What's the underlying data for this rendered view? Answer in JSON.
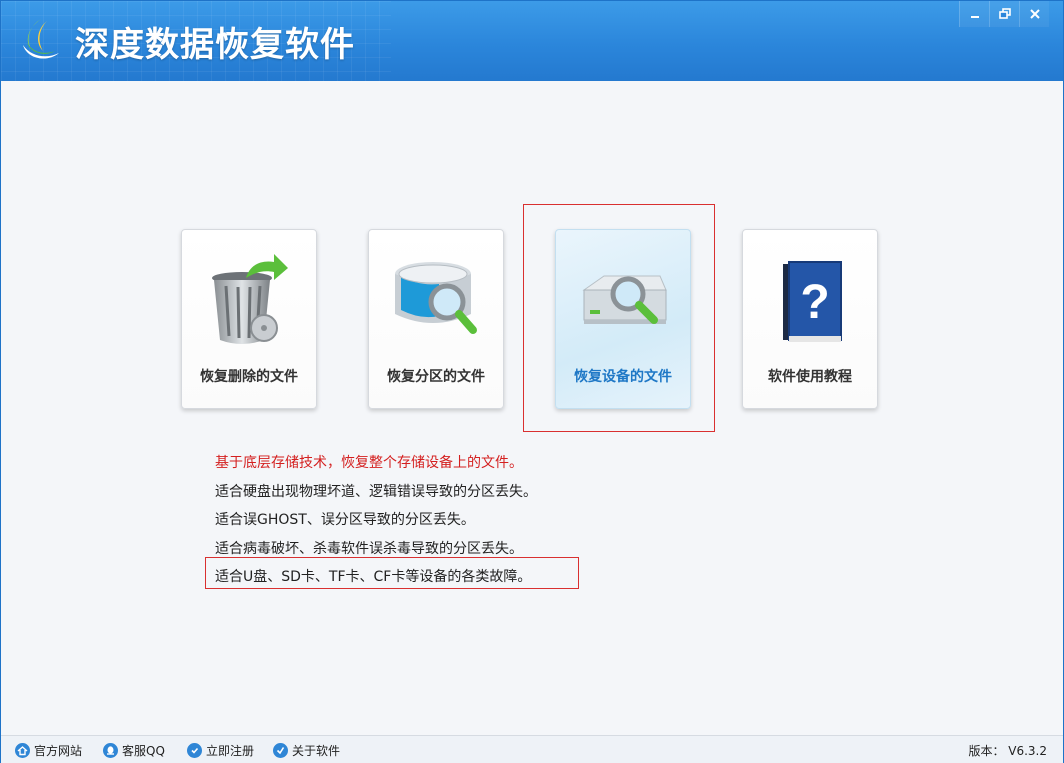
{
  "window": {
    "title": "深度数据恢复软件",
    "controls": [
      "minimize",
      "restore",
      "close"
    ]
  },
  "cards": [
    {
      "label": "恢复删除的文件",
      "icon": "trash-restore-icon",
      "selected": false
    },
    {
      "label": "恢复分区的文件",
      "icon": "partition-scan-icon",
      "selected": false
    },
    {
      "label": "恢复设备的文件",
      "icon": "device-scan-icon",
      "selected": true
    },
    {
      "label": "软件使用教程",
      "icon": "help-book-icon",
      "selected": false
    }
  ],
  "description": {
    "headline": "基于底层存储技术，恢复整个存储设备上的文件。",
    "lines": [
      "适合硬盘出现物理坏道、逻辑错误导致的分区丢失。",
      "适合误GHOST、误分区导致的分区丢失。",
      "适合病毒破坏、杀毒软件误杀毒导致的分区丢失。",
      "适合U盘、SD卡、TF卡、CF卡等设备的各类故障。"
    ]
  },
  "footer": {
    "links": [
      {
        "label": "官方网站",
        "icon": "home-icon"
      },
      {
        "label": "客服QQ",
        "icon": "qq-icon"
      },
      {
        "label": "立即注册",
        "icon": "register-icon"
      },
      {
        "label": "关于软件",
        "icon": "about-icon"
      }
    ],
    "version": "版本： V6.3.2"
  },
  "colors": {
    "titlebar": "#2b86db",
    "accent": "#1f78c6",
    "highlight_frame": "#d93030",
    "headline_text": "#d42020"
  }
}
